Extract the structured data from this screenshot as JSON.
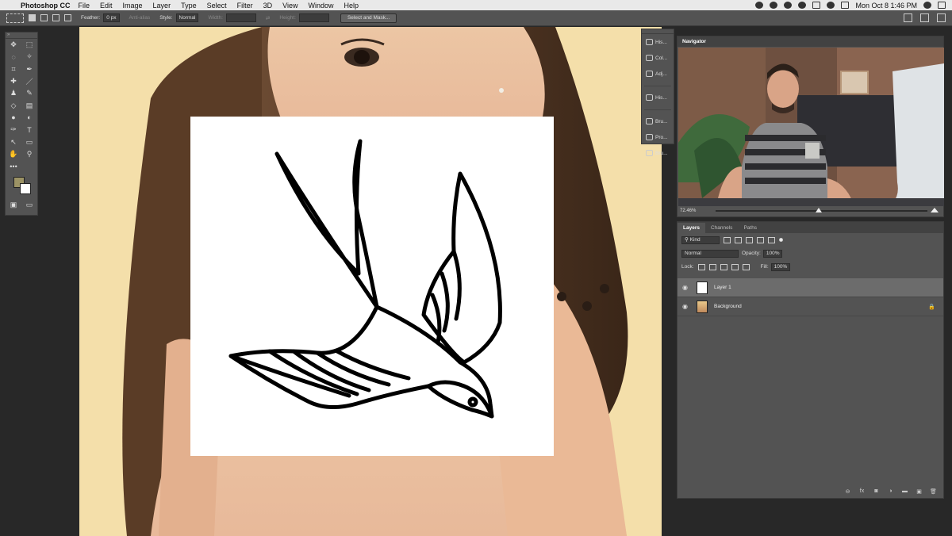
{
  "menubar": {
    "apple": "",
    "app_name": "Photoshop CC",
    "items": [
      "File",
      "Edit",
      "Image",
      "Layer",
      "Type",
      "Select",
      "Filter",
      "3D",
      "View",
      "Window",
      "Help"
    ],
    "clock": "Mon Oct 8  1:46 PM"
  },
  "options": {
    "feather_label": "Feather:",
    "feather_value": "0 px",
    "anti_alias": "Anti-alias",
    "style_label": "Style:",
    "style_value": "Normal",
    "width_label": "Width:",
    "height_label": "Height:",
    "select_mask": "Select and Mask..."
  },
  "tools": {
    "rows": [
      [
        "✥",
        "⬚"
      ],
      [
        "◌",
        "✧"
      ],
      [
        "⌗",
        "✒"
      ],
      [
        "✚",
        "／"
      ],
      [
        "♟",
        "✎"
      ],
      [
        "◇",
        "▤"
      ],
      [
        "●",
        "◐"
      ],
      [
        "✑",
        "T"
      ],
      [
        "↖",
        "▭"
      ],
      [
        "✋",
        "⚲"
      ],
      [
        "•••",
        ""
      ]
    ]
  },
  "strip": {
    "items": [
      "His...",
      "Col...",
      "Adj...",
      "His...",
      "Bru...",
      "Pro...",
      "Bru..."
    ]
  },
  "navigator": {
    "title": "Navigator",
    "zoom": "72.46%"
  },
  "layers": {
    "tabs": [
      "Layers",
      "Channels",
      "Paths"
    ],
    "kind": "Kind",
    "blend": "Normal",
    "opacity_label": "Opacity:",
    "opacity_value": "100%",
    "lock_label": "Lock:",
    "fill_label": "Fill:",
    "fill_value": "100%",
    "items": [
      {
        "name": "Layer 1"
      },
      {
        "name": "Background"
      }
    ],
    "footer": [
      "⊖",
      "fx",
      "◙",
      "◑",
      "▬",
      "▣",
      "🗑"
    ]
  },
  "colors": {
    "foreground": "#9c9365",
    "background": "#ffffff"
  }
}
